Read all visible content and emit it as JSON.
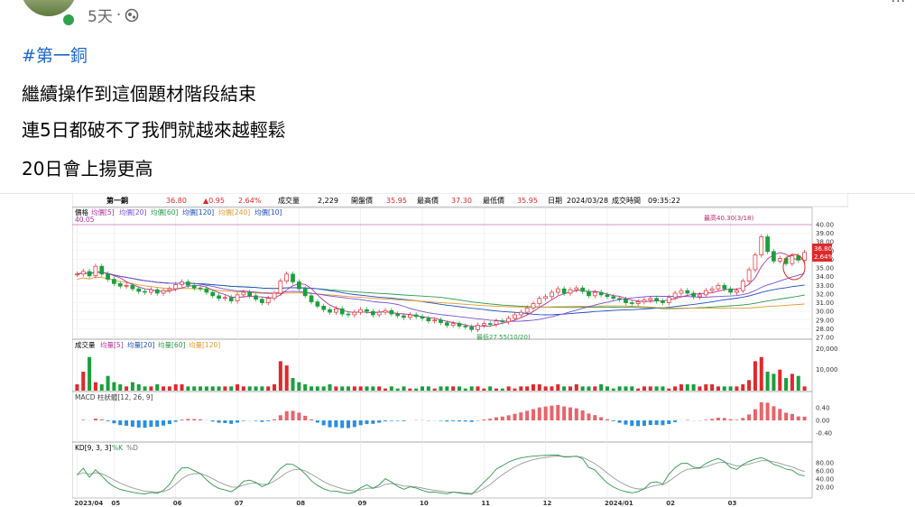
{
  "post": {
    "time": "5天",
    "hashtag": "#第一銅",
    "lines": [
      "繼續操作到這個題材階段結束",
      "連5日都破不了我們就越來越輕鬆",
      "20日會上揚更高"
    ],
    "more": "···"
  },
  "quote": {
    "name": "第一銅",
    "price": "36.80",
    "change": "▲0.95",
    "pct": "2.64%",
    "vol_label": "成交量",
    "vol": "2,229",
    "open_label": "開盤價",
    "open": "35.95",
    "high_label": "最高價",
    "high": "37.30",
    "low_label": "最低價",
    "low": "35.95",
    "date_label": "日期",
    "date": "2024/03/28",
    "time_label": "成交時間",
    "time": "09:35:22"
  },
  "colors": {
    "up": "#e0292b",
    "down": "#18a03b",
    "ma5": "#b5329b",
    "ma20": "#7b4fd6",
    "ma60": "#2c9a4c",
    "ma120": "#1f4fbf",
    "ma240": "#e39a2b",
    "ma10": "#8c8c8c"
  },
  "chart_data": {
    "type": "line",
    "price_legend": [
      "價格",
      "均價[5]",
      "均價[20]",
      "均價[60]",
      "均價[120]",
      "均價[240]",
      "均價[10]"
    ],
    "price_legend_sub": "40.05",
    "price_ticks": [
      "40.00",
      "39.00",
      "38.00",
      "37.00",
      "36.00",
      "35.00",
      "34.00",
      "33.00",
      "32.00",
      "31.00",
      "30.00",
      "29.00",
      "28.00",
      "27.00"
    ],
    "price_ylim": [
      27,
      40
    ],
    "high_marker": "最高40.30(3/18)",
    "low_marker": "最低27.55(10/20)",
    "last_price": "36.80",
    "last_pct": "2.64%",
    "close": [
      34.3,
      34.6,
      34.1,
      35.2,
      34.3,
      33.7,
      33.2,
      32.9,
      33.0,
      32.6,
      32.3,
      32.2,
      32.5,
      32.1,
      32.4,
      32.6,
      33.1,
      33.4,
      33.0,
      32.7,
      32.6,
      32.2,
      31.8,
      31.5,
      31.6,
      31.2,
      31.9,
      32.2,
      31.8,
      31.4,
      31.0,
      31.5,
      32.1,
      33.5,
      34.3,
      33.4,
      32.6,
      31.8,
      31.1,
      30.6,
      30.2,
      29.9,
      30.3,
      29.7,
      29.6,
      29.9,
      30.2,
      30.0,
      29.6,
      29.9,
      30.1,
      29.7,
      29.5,
      29.3,
      29.6,
      29.4,
      29.2,
      28.9,
      29.0,
      28.7,
      28.4,
      28.6,
      28.3,
      28.2,
      27.9,
      28.4,
      28.6,
      28.5,
      28.9,
      28.8,
      29.2,
      29.6,
      29.9,
      30.4,
      30.9,
      31.5,
      31.7,
      32.2,
      32.6,
      32.1,
      32.5,
      32.7,
      32.3,
      31.8,
      32.2,
      31.9,
      31.7,
      31.5,
      31.4,
      31.0,
      30.9,
      31.1,
      31.3,
      31.5,
      31.2,
      31.0,
      31.6,
      32.1,
      32.4,
      32.1,
      31.7,
      31.9,
      32.4,
      32.6,
      33.0,
      32.6,
      32.2,
      32.4,
      33.5,
      34.8,
      36.5,
      38.6,
      36.9,
      35.8,
      36.1,
      35.5,
      36.4,
      35.9,
      36.8
    ],
    "volume_legend": [
      "成交量",
      "均量[5]",
      "均量[20]",
      "均量[60]",
      "均量[120]"
    ],
    "volume_ticks": [
      "20,000",
      "10,000"
    ],
    "volume": [
      3,
      9,
      16,
      4,
      3,
      7,
      4,
      3,
      2,
      4,
      3,
      2,
      2,
      3,
      2,
      2,
      3,
      3,
      2,
      2,
      2,
      2,
      2,
      2,
      2,
      2,
      3,
      2,
      2,
      2,
      2,
      2,
      3,
      14,
      12,
      6,
      4,
      3,
      2,
      2,
      2,
      3,
      2,
      2,
      2,
      2,
      2,
      2,
      2,
      2,
      1,
      2,
      1,
      2,
      1,
      1,
      2,
      2,
      1,
      2,
      2,
      2,
      2,
      1,
      2,
      2,
      1,
      2,
      1,
      1,
      2,
      1,
      2,
      2,
      3,
      3,
      2,
      2,
      3,
      2,
      2,
      3,
      2,
      2,
      2,
      3,
      2,
      1,
      2,
      2,
      2,
      1,
      2,
      2,
      2,
      2,
      1,
      2,
      3,
      3,
      3,
      2,
      3,
      3,
      2,
      2,
      2,
      2,
      3,
      5,
      14,
      16,
      9,
      8,
      10,
      6,
      8,
      7,
      2
    ],
    "macd_legend": "MACD 柱狀體[12, 26, 9]",
    "macd_ticks": [
      "0.40",
      "0.00",
      "-0.40"
    ],
    "kd_legend": [
      "KD[9, 3, 3]",
      "%K",
      "%D"
    ],
    "kd_ticks": [
      "80.00",
      "60.00",
      "40.00",
      "20.00"
    ],
    "x_labels": [
      "2023/04",
      "05",
      "06",
      "07",
      "08",
      "09",
      "10",
      "11",
      "12",
      "2024/01",
      "02",
      "03"
    ],
    "x_label_index": [
      0,
      6,
      16,
      26,
      36,
      46,
      56,
      66,
      76,
      86,
      96,
      106
    ]
  }
}
